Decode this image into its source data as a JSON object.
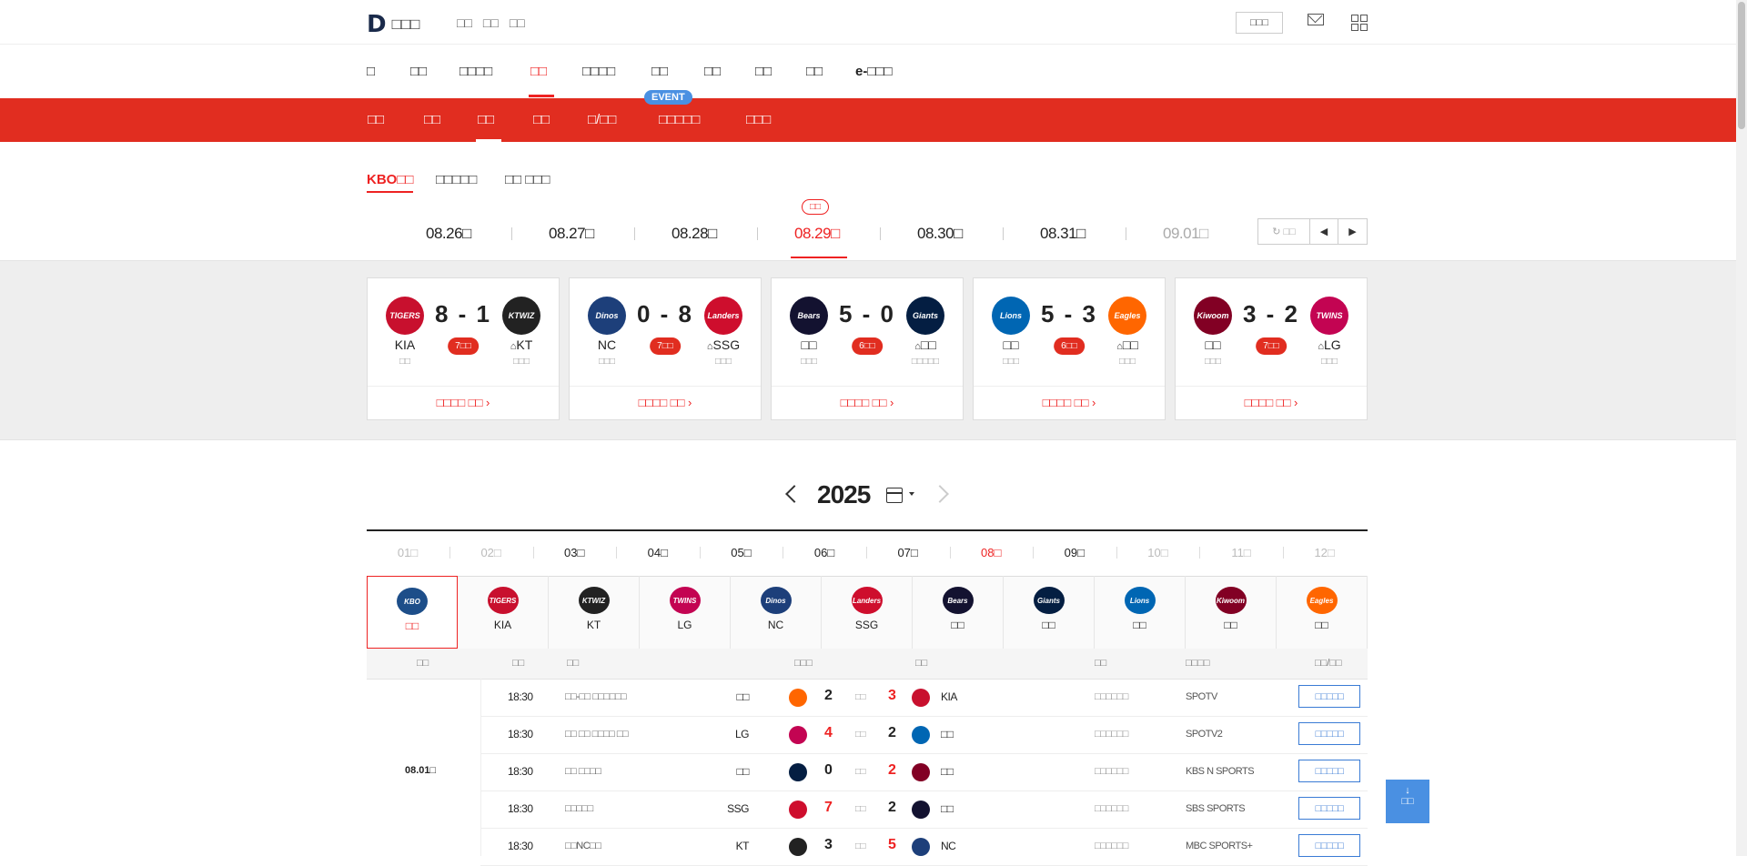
{
  "header": {
    "logo_text": "D",
    "brand": "□□□",
    "links": [
      "□□",
      "□□",
      "□□"
    ],
    "login_label": "□□□"
  },
  "main_nav": {
    "items": [
      "□",
      "□□",
      "□□□□",
      "□□",
      "□□□□",
      "□□",
      "□□",
      "□□",
      "□□",
      "e-□□□"
    ],
    "active_index": 3
  },
  "sub_nav": {
    "items": [
      "□□",
      "□□",
      "□□",
      "□□",
      "□/□□",
      "□□□□□",
      "□□□"
    ],
    "active_index": 2,
    "event_badge": "EVENT"
  },
  "kbo_tabs": [
    "KBO□□",
    "□□□□□",
    "□□ □□□"
  ],
  "date_strip": {
    "today_label": "□□",
    "dates": [
      "08.26□",
      "08.27□",
      "08.28□",
      "08.29□",
      "08.30□",
      "08.31□",
      "09.01□"
    ],
    "active_index": 3,
    "refresh_label": "□□"
  },
  "games": [
    {
      "away": "KIA",
      "home": "KT",
      "score": "8 - 1",
      "inning": "7□□",
      "away_pitcher": "□□",
      "home_pitcher": "□□□",
      "away_logo": "TIGERS",
      "home_logo": "KTWIZ",
      "away_color": "#c8102e",
      "home_color": "#222222",
      "link": "□□□□ □□ ›"
    },
    {
      "away": "NC",
      "home": "SSG",
      "score": "0 - 8",
      "inning": "7□□",
      "away_pitcher": "□□□",
      "home_pitcher": "□□□",
      "away_logo": "Dinos",
      "home_logo": "Landers",
      "away_color": "#1d3f7a",
      "home_color": "#ce0e2d",
      "link": "□□□□ □□ ›"
    },
    {
      "away": "□□",
      "home": "□□",
      "score": "5 - 0",
      "inning": "6□□",
      "away_pitcher": "□□□",
      "home_pitcher": "□□□□□",
      "away_logo": "Bears",
      "home_logo": "Giants",
      "away_color": "#131230",
      "home_color": "#041e42",
      "link": "□□□□ □□ ›"
    },
    {
      "away": "□□",
      "home": "□□",
      "score": "5 - 3",
      "inning": "6□□",
      "away_pitcher": "□□□",
      "home_pitcher": "□□□",
      "away_logo": "Lions",
      "home_logo": "Eagles",
      "away_color": "#0066b3",
      "home_color": "#ff6600",
      "link": "□□□□ □□ ›"
    },
    {
      "away": "□□",
      "home": "LG",
      "score": "3 - 2",
      "inning": "7□□",
      "away_pitcher": "□□□",
      "home_pitcher": "□□□",
      "away_logo": "Kiwoom",
      "home_logo": "TWINS",
      "away_color": "#820024",
      "home_color": "#c30452",
      "link": "□□□□ □□ ›"
    }
  ],
  "year_selector": {
    "year": "2025"
  },
  "months": [
    "01□",
    "02□",
    "03□",
    "04□",
    "05□",
    "06□",
    "07□",
    "08□",
    "09□",
    "10□",
    "11□",
    "12□"
  ],
  "month_state": [
    "dim",
    "dim",
    "",
    "",
    "",
    "",
    "",
    "active",
    "",
    "dim",
    "dim",
    "dim"
  ],
  "team_filter": [
    {
      "label": "□□",
      "logo": "KBO",
      "color": "#1d4e89"
    },
    {
      "label": "KIA",
      "logo": "TIGERS",
      "color": "#c8102e"
    },
    {
      "label": "KT",
      "logo": "KTWIZ",
      "color": "#222222"
    },
    {
      "label": "LG",
      "logo": "TWINS",
      "color": "#c30452"
    },
    {
      "label": "NC",
      "logo": "Dinos",
      "color": "#1d3f7a"
    },
    {
      "label": "SSG",
      "logo": "Landers",
      "color": "#ce0e2d"
    },
    {
      "label": "□□",
      "logo": "Bears",
      "color": "#131230"
    },
    {
      "label": "□□",
      "logo": "Giants",
      "color": "#041e42"
    },
    {
      "label": "□□",
      "logo": "Lions",
      "color": "#0066b3"
    },
    {
      "label": "□□",
      "logo": "Kiwoom",
      "color": "#820024"
    },
    {
      "label": "□□",
      "logo": "Eagles",
      "color": "#ff6600"
    }
  ],
  "schedule_headers": [
    "□□",
    "□□",
    "□□",
    "□□□",
    "□□",
    "□□",
    "□□□□",
    "□□/□□"
  ],
  "schedule": {
    "date": "08.01□",
    "rows": [
      {
        "time": "18:30",
        "venue": "□□-□□ □□□□□□",
        "away": "□□",
        "away_score": "2",
        "home_score": "3",
        "home": "KIA",
        "win": "home",
        "vs": "□□",
        "status": "□□□□□□",
        "tv": "SPOTV",
        "btn": "□□□□□",
        "away_color": "#ff6600",
        "home_color": "#c8102e"
      },
      {
        "time": "18:30",
        "venue": "□□ □□ □□□□ □□",
        "away": "LG",
        "away_score": "4",
        "home_score": "2",
        "home": "□□",
        "win": "away",
        "vs": "□□",
        "status": "□□□□□□",
        "tv": "SPOTV2",
        "btn": "□□□□□",
        "away_color": "#c30452",
        "home_color": "#0066b3"
      },
      {
        "time": "18:30",
        "venue": "□□ □□□□",
        "away": "□□",
        "away_score": "0",
        "home_score": "2",
        "home": "□□",
        "win": "home",
        "vs": "□□",
        "status": "□□□□□□",
        "tv": "KBS N SPORTS",
        "btn": "□□□□□",
        "away_color": "#041e42",
        "home_color": "#820024"
      },
      {
        "time": "18:30",
        "venue": "□□□□□",
        "away": "SSG",
        "away_score": "7",
        "home_score": "2",
        "home": "□□",
        "win": "away",
        "vs": "□□",
        "status": "□□□□□□",
        "tv": "SBS SPORTS",
        "btn": "□□□□□",
        "away_color": "#ce0e2d",
        "home_color": "#131230"
      },
      {
        "time": "18:30",
        "venue": "□□NC□□",
        "away": "KT",
        "away_score": "3",
        "home_score": "5",
        "home": "NC",
        "win": "home",
        "vs": "□□",
        "status": "□□□□□□",
        "tv": "MBC SPORTS+",
        "btn": "□□□□□",
        "away_color": "#222222",
        "home_color": "#1d3f7a"
      }
    ]
  },
  "scroll_button": {
    "label": "□□"
  }
}
